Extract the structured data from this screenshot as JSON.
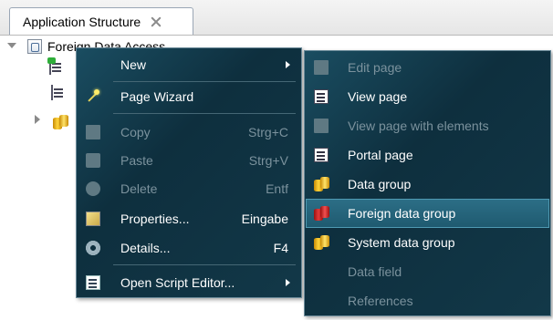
{
  "panel": {
    "tab_title": "Application Structure",
    "root_label": "Foreign Data Access"
  },
  "context_menu": {
    "items": [
      {
        "label": "New",
        "shortcut": "",
        "icon": "none",
        "enabled": true,
        "submenu": true
      },
      {
        "label": "Page Wizard",
        "shortcut": "",
        "icon": "wand-icon",
        "enabled": true
      },
      {
        "label": "Copy",
        "shortcut": "Strg+C",
        "icon": "copy-icon",
        "enabled": false
      },
      {
        "label": "Paste",
        "shortcut": "Strg+V",
        "icon": "paste-icon",
        "enabled": false
      },
      {
        "label": "Delete",
        "shortcut": "Entf",
        "icon": "delete-icon",
        "enabled": false
      },
      {
        "label": "Properties...",
        "shortcut": "Eingabe",
        "icon": "properties-icon",
        "enabled": true
      },
      {
        "label": "Details...",
        "shortcut": "F4",
        "icon": "gear-icon",
        "enabled": true
      },
      {
        "label": "Open Script Editor...",
        "shortcut": "",
        "icon": "script-icon",
        "enabled": true,
        "submenu": true
      }
    ]
  },
  "submenu_new": {
    "items": [
      {
        "label": "Edit page",
        "icon": "page-icon",
        "enabled": false
      },
      {
        "label": "View page",
        "icon": "page-icon",
        "enabled": true
      },
      {
        "label": "View page with elements",
        "icon": "page-icon",
        "enabled": false
      },
      {
        "label": "Portal page",
        "icon": "page-icon",
        "enabled": true
      },
      {
        "label": "Data group",
        "icon": "data-group-icon",
        "enabled": true
      },
      {
        "label": "Foreign data group",
        "icon": "foreign-data-group-icon",
        "enabled": true,
        "highlighted": true
      },
      {
        "label": "System data group",
        "icon": "data-group-icon",
        "enabled": true
      },
      {
        "label": "Data field",
        "icon": "none",
        "enabled": false
      },
      {
        "label": "References",
        "icon": "none",
        "enabled": false
      }
    ]
  },
  "colors": {
    "menu_bg": "#0e2f3e",
    "highlight": "#2c6e86",
    "disabled_text": "#7b929d"
  }
}
